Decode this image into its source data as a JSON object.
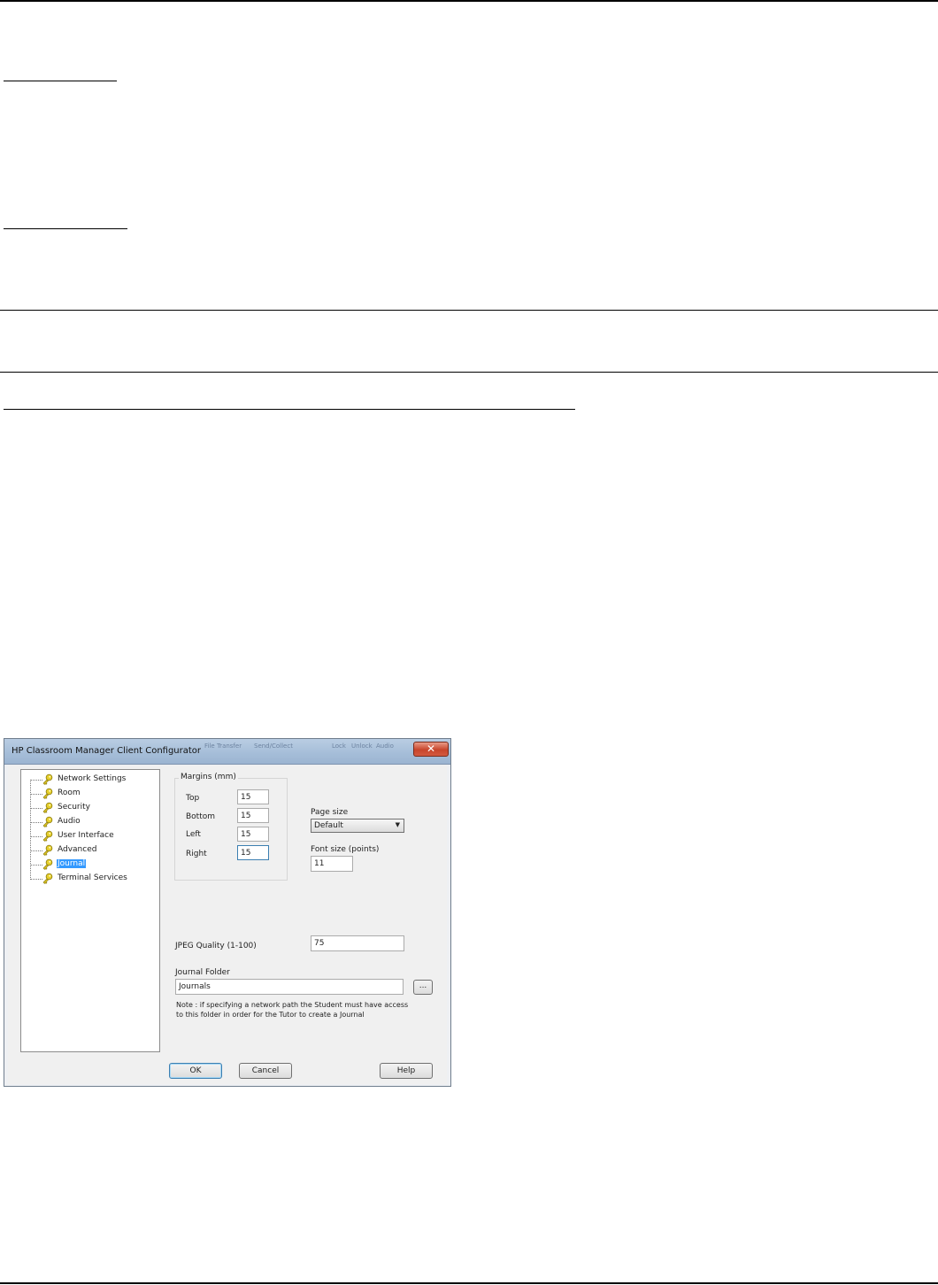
{
  "dialog": {
    "title": "HP Classroom Manager Client Configurator",
    "ghost_texts": [
      "File Transfer",
      "Send/Collect",
      "Lock",
      "Unlock",
      "Audio"
    ],
    "close_glyph": "✕",
    "tree": {
      "items": [
        {
          "label": "Network Settings",
          "icon": "key-icon"
        },
        {
          "label": "Room",
          "icon": "key-icon"
        },
        {
          "label": "Security",
          "icon": "key-icon"
        },
        {
          "label": "Audio",
          "icon": "key-icon"
        },
        {
          "label": "User Interface",
          "icon": "key-icon"
        },
        {
          "label": "Advanced",
          "icon": "key-icon"
        },
        {
          "label": "Journal",
          "icon": "key-icon",
          "selected": true
        },
        {
          "label": "Terminal Services",
          "icon": "key-icon"
        }
      ]
    },
    "margins": {
      "title": "Margins (mm)",
      "top_label": "Top",
      "top_value": "15",
      "bottom_label": "Bottom",
      "bottom_value": "15",
      "left_label": "Left",
      "left_value": "15",
      "right_label": "Right",
      "right_value": "15"
    },
    "page_size": {
      "label": "Page size",
      "value": "Default"
    },
    "font_size": {
      "label": "Font size (points)",
      "value": "11"
    },
    "jpeg_quality": {
      "label": "JPEG Quality (1-100)",
      "value": "75"
    },
    "journal_folder": {
      "label": "Journal Folder",
      "value": "Journals",
      "browse_label": "..."
    },
    "note": "Note : if specifying a network path the Student must have access to this folder in order for the Tutor to create a Journal",
    "buttons": {
      "ok": "OK",
      "cancel": "Cancel",
      "help": "Help"
    }
  },
  "colors": {
    "selection": "#3399ff",
    "close": "#c8452c",
    "titlebar": "#a5bdd8"
  }
}
